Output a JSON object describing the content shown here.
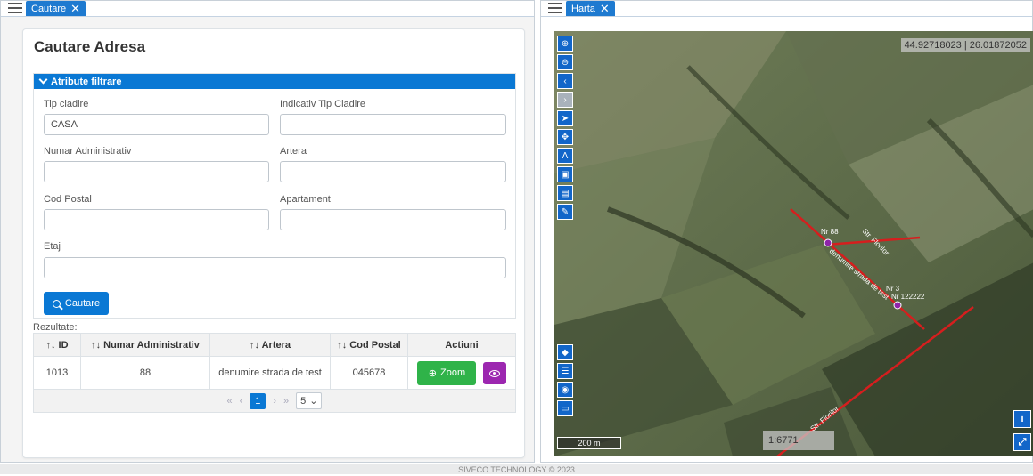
{
  "left_tab": {
    "label": "Cautare",
    "close": "✕"
  },
  "right_tab": {
    "label": "Harta",
    "close": "✕"
  },
  "search": {
    "title": "Cautare Adresa",
    "accordion_title": "Atribute filtrare",
    "fields": {
      "tip_cladire": {
        "label": "Tip cladire",
        "value": "CASA"
      },
      "indicativ": {
        "label": "Indicativ Tip Cladire",
        "value": ""
      },
      "numar_adm": {
        "label": "Numar Administrativ",
        "value": ""
      },
      "artera": {
        "label": "Artera",
        "value": ""
      },
      "cod_postal": {
        "label": "Cod Postal",
        "value": ""
      },
      "apartament": {
        "label": "Apartament",
        "value": ""
      },
      "etaj": {
        "label": "Etaj",
        "value": ""
      }
    },
    "button": "Cautare"
  },
  "results": {
    "label": "Rezultate:",
    "headers": [
      "↑↓ ID",
      "↑↓ Numar Administrativ",
      "↑↓ Artera",
      "↑↓ Cod Postal",
      "Actiuni"
    ],
    "rows": [
      {
        "id": "1013",
        "numar": "88",
        "artera": "denumire strada de test",
        "cod": "045678"
      }
    ],
    "zoom_label": "Zoom",
    "pager": {
      "first": "«",
      "prev": "‹",
      "page": "1",
      "next": "›",
      "last": "»",
      "size": "5"
    }
  },
  "map": {
    "coords": "44.92718023 | 26.01872052",
    "scalebar": "200 m",
    "scale": "1:6771",
    "labels": {
      "nr88": "Nr 88",
      "str_florilor": "Str. Florilor",
      "nr3": "Nr 3",
      "nr_big": "Nr 122222",
      "denumire": "denumire strada de test",
      "strada_lat": "Str. Florilor"
    },
    "info_btn": "i"
  },
  "footer": "SIVECO TECHNOLOGY © 2023",
  "colors": {
    "primary": "#0a78d4",
    "success": "#2fb349",
    "purple": "#9c27b0",
    "road": "#d61e1e"
  }
}
